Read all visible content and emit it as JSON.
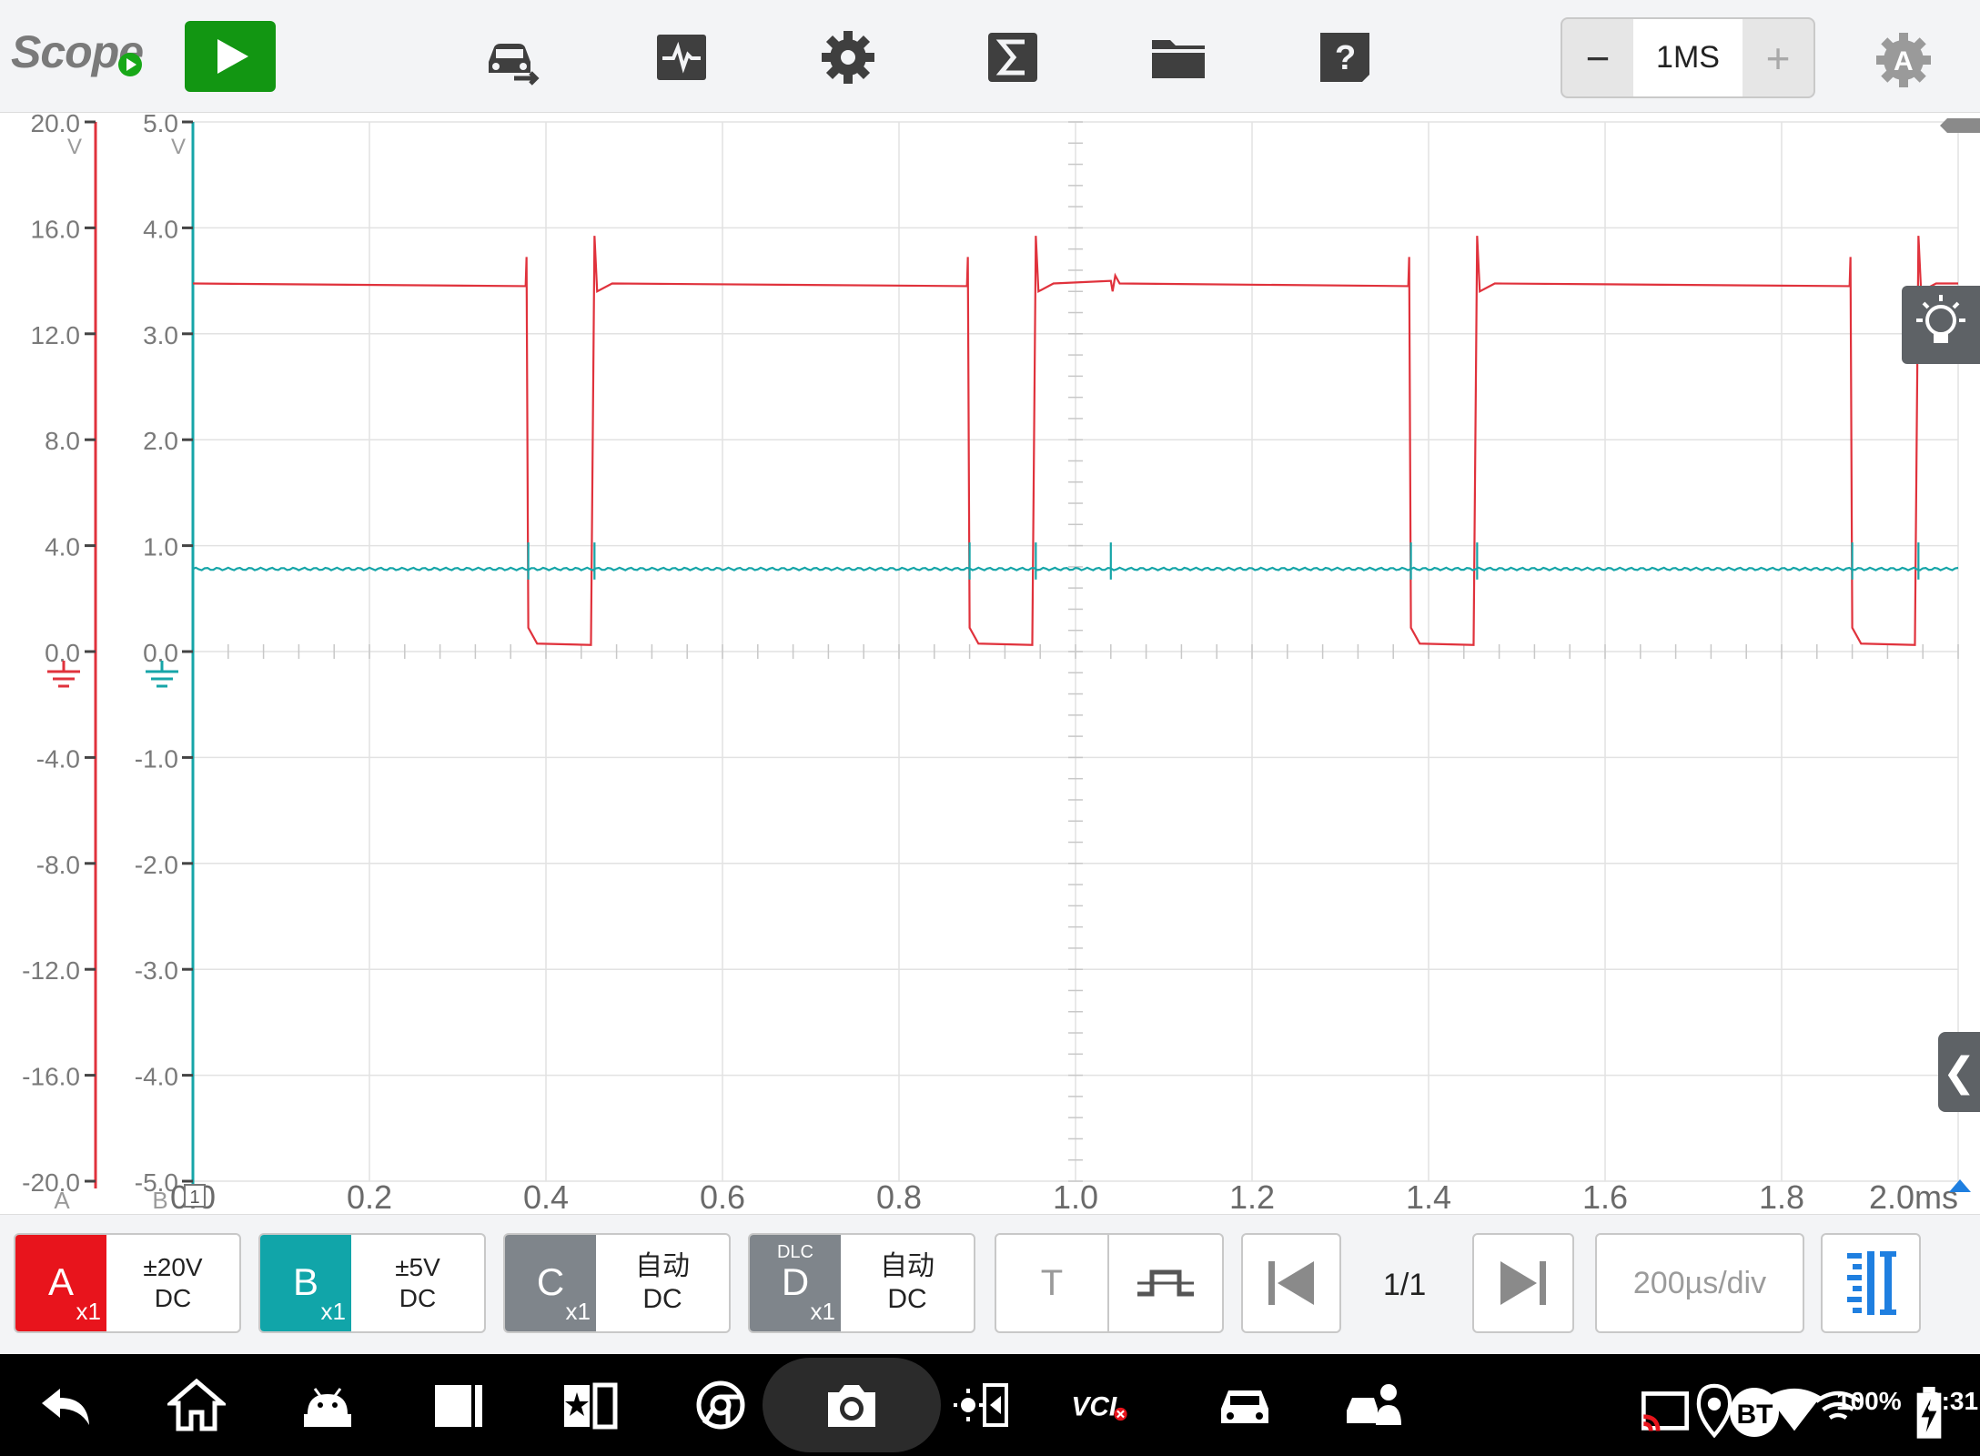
{
  "header": {
    "app_title": "Scope",
    "timescale_value": "1MS",
    "minus_label": "−",
    "plus_label": "+",
    "help_label": "?",
    "gear_a_label": "A"
  },
  "axes": {
    "a_label": "A",
    "b_label": "B",
    "a_unit": "V",
    "b_unit": "V",
    "a_ticks": [
      "20.0",
      "16.0",
      "12.0",
      "8.0",
      "4.0",
      "0.0",
      "-4.0",
      "-8.0",
      "-12.0",
      "-16.0",
      "-20.0"
    ],
    "b_ticks": [
      "5.0",
      "4.0",
      "3.0",
      "2.0",
      "1.0",
      "0.0",
      "-1.0",
      "-2.0",
      "-3.0",
      "-4.0",
      "-5.0"
    ],
    "x_ticks": [
      "0.0",
      "0.2",
      "0.4",
      "0.6",
      "0.8",
      "1.0",
      "1.2",
      "1.4",
      "1.6",
      "1.8",
      "2.0ms"
    ],
    "trigger_label": "1"
  },
  "chart_data": {
    "type": "line",
    "x_unit": "ms",
    "xlim": [
      0,
      2.0
    ],
    "channel_a": {
      "name": "A",
      "color": "#e0323c",
      "ylim": [
        -20,
        20
      ],
      "unit": "V",
      "high_level": 13.9,
      "low_level": 0.3,
      "pulse_starts": [
        0.38,
        0.88,
        1.38,
        1.88
      ],
      "pulse_width": 0.075,
      "spike_peak": 15.7
    },
    "channel_b": {
      "name": "B",
      "color": "#16a5a8",
      "ylim": [
        -5,
        5
      ],
      "unit": "V",
      "level": 0.78,
      "spike_times": [
        0.38,
        0.455,
        0.88,
        0.955,
        1.38,
        1.455,
        1.88,
        1.955,
        1.04
      ]
    }
  },
  "channels": [
    {
      "letter": "A",
      "mult": "x1",
      "range": "±20V",
      "coupling": "DC",
      "color": "#e8141c",
      "extra": ""
    },
    {
      "letter": "B",
      "mult": "x1",
      "range": "±5V",
      "coupling": "DC",
      "color": "#11a5a9",
      "extra": ""
    },
    {
      "letter": "C",
      "mult": "x1",
      "range": "自动",
      "coupling": "DC",
      "color": "#7f858b",
      "extra": ""
    },
    {
      "letter": "D",
      "mult": "x1",
      "range": "自动",
      "coupling": "DC",
      "color": "#7f858b",
      "extra": "DLC"
    }
  ],
  "bottom_tools": {
    "trigger_label": "T",
    "page_indicator": "1/1",
    "timebase": "200µs/div"
  },
  "status": {
    "battery": "100%",
    "time": "2:31",
    "bt": "BT",
    "vci": "VCI"
  },
  "colors": {
    "accent_blue": "#1f7fe0",
    "run_green": "#129612"
  }
}
